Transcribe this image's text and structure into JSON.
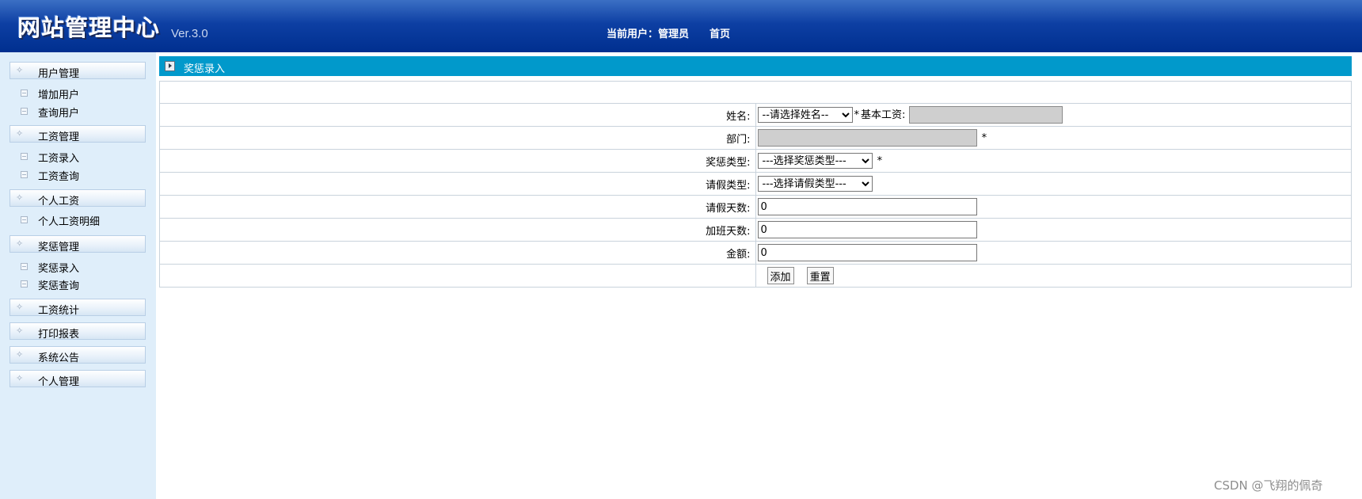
{
  "header": {
    "title": "网站管理中心",
    "version": "Ver.3.0",
    "current_user_label": "当前用户：管理员",
    "home_link": "首页"
  },
  "sidebar": {
    "groups": [
      {
        "label": "用户管理",
        "items": [
          "增加用户",
          "查询用户"
        ]
      },
      {
        "label": "工资管理",
        "items": [
          "工资录入",
          "工资查询"
        ]
      },
      {
        "label": "个人工资",
        "items": [
          "个人工资明细"
        ]
      },
      {
        "label": "奖惩管理",
        "items": [
          "奖惩录入",
          "奖惩查询"
        ]
      },
      {
        "label": "工资统计",
        "items": []
      },
      {
        "label": "打印报表",
        "items": []
      },
      {
        "label": "系统公告",
        "items": []
      },
      {
        "label": "个人管理",
        "items": []
      }
    ]
  },
  "panel": {
    "title": "奖惩录入"
  },
  "form": {
    "name_label": "姓名:",
    "name_select": "--请选择姓名--",
    "required_mark": "*",
    "base_salary_label": "基本工资:",
    "base_salary_value": "",
    "dept_label": "部门:",
    "dept_value": "",
    "reward_type_label": "奖惩类型:",
    "reward_type_select": "---选择奖惩类型---",
    "leave_type_label": "请假类型:",
    "leave_type_select": "---选择请假类型---",
    "leave_days_label": "请假天数:",
    "leave_days_value": "0",
    "overtime_days_label": "加班天数:",
    "overtime_days_value": "0",
    "amount_label": "金额:",
    "amount_value": "0",
    "add_button": "添加",
    "reset_button": "重置"
  },
  "watermark": "CSDN @飞翔的佩奇"
}
